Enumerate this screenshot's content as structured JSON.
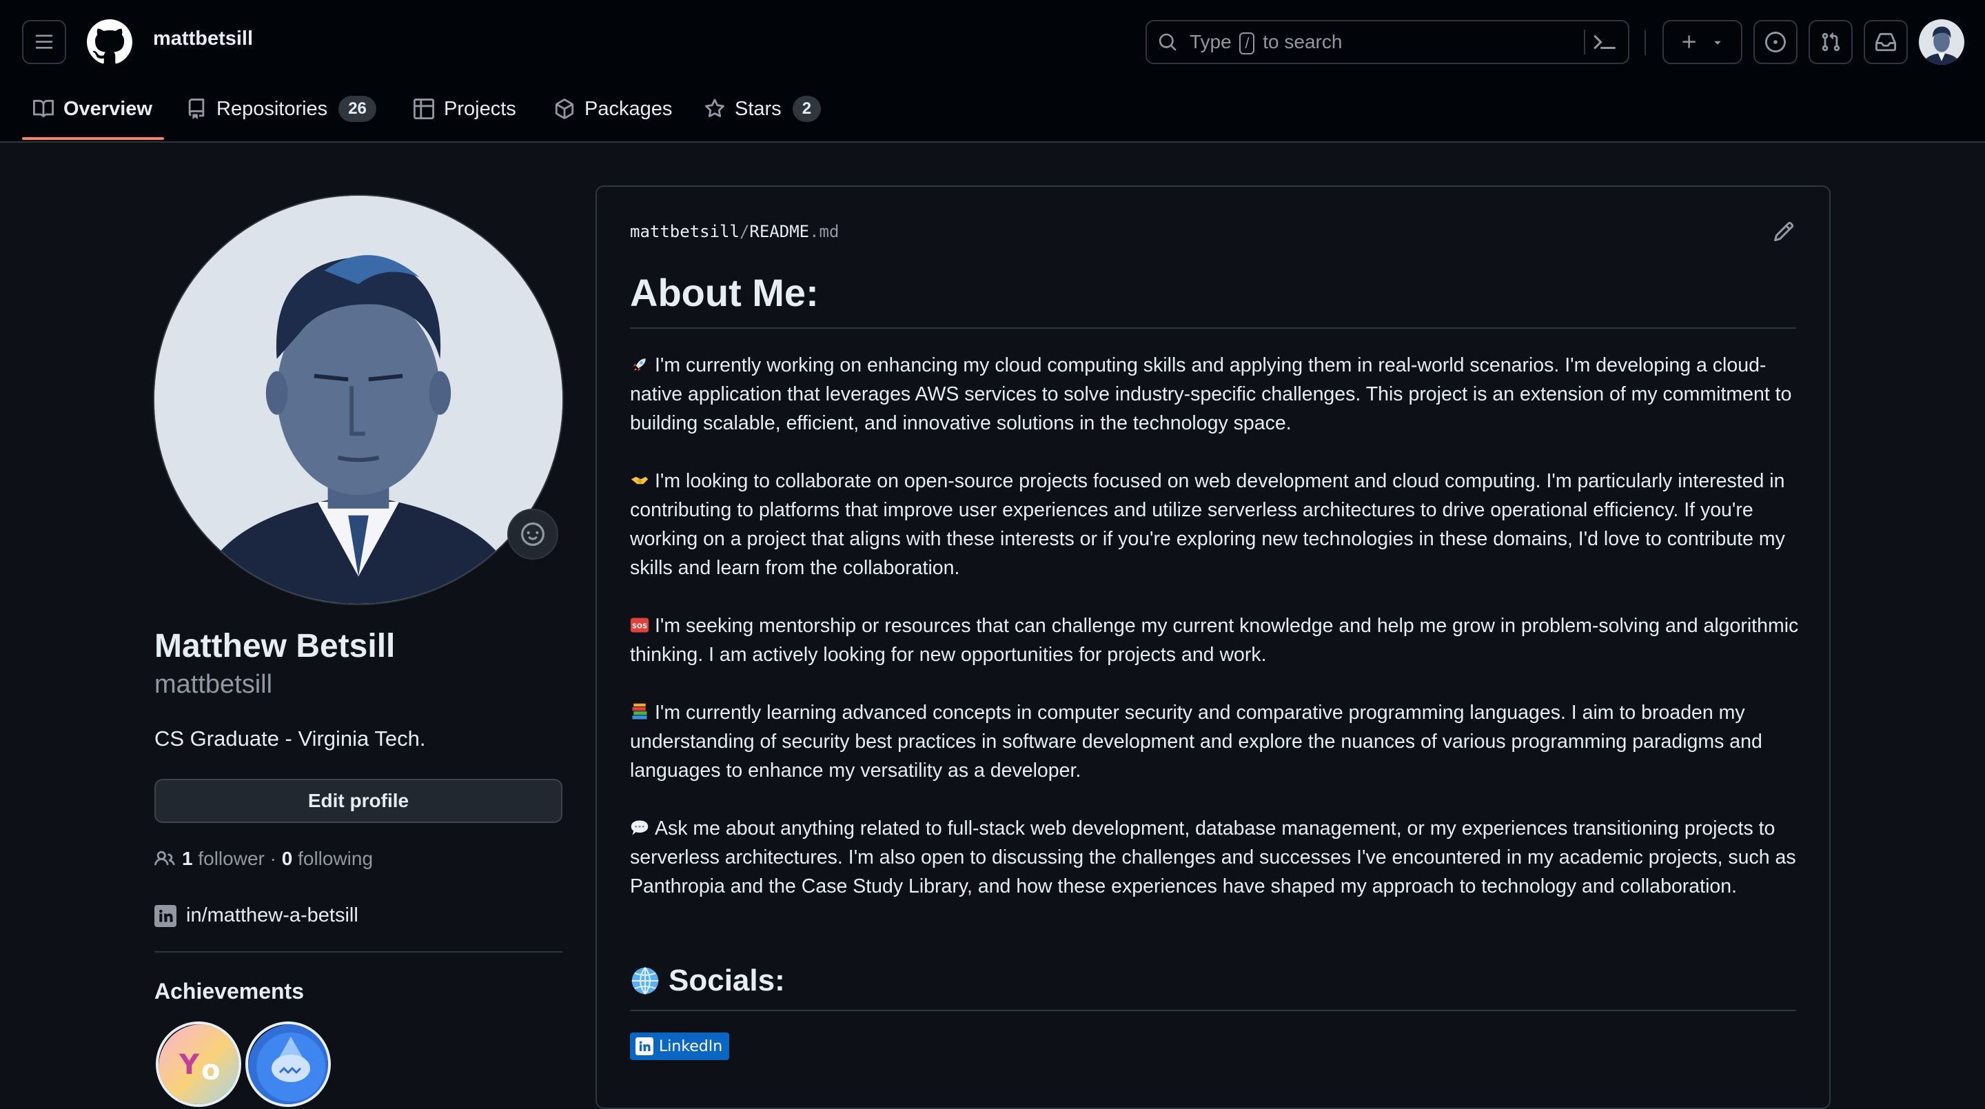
{
  "header": {
    "username": "mattbetsill",
    "search": {
      "prefix": "Type",
      "key": "/",
      "suffix": "to search"
    }
  },
  "tabs": [
    {
      "label": "Overview",
      "icon": "book-icon"
    },
    {
      "label": "Repositories",
      "icon": "repo-icon",
      "count": "26"
    },
    {
      "label": "Projects",
      "icon": "table-icon"
    },
    {
      "label": "Packages",
      "icon": "package-icon"
    },
    {
      "label": "Stars",
      "icon": "star-icon",
      "count": "2"
    }
  ],
  "profile": {
    "name": "Matthew Betsill",
    "login": "mattbetsill",
    "bio": "CS Graduate - Virginia Tech.",
    "edit_label": "Edit profile",
    "followers": "1",
    "followers_label": "follower",
    "dot": "·",
    "following": "0",
    "following_label": "following",
    "linkedin": "in/matthew-a-betsill",
    "achievements_title": "Achievements"
  },
  "readme": {
    "owner": "mattbetsill",
    "slash": "/",
    "file": "README",
    "ext": ".md",
    "heading": "About Me:",
    "paragraphs": [
      {
        "emoji": "rocket",
        "text": "I'm currently working on enhancing my cloud computing skills and applying them in real-world scenarios. I'm developing a cloud-native application that leverages AWS services to solve industry-specific challenges. This project is an extension of my commitment to building scalable, efficient, and innovative solutions in the technology space."
      },
      {
        "emoji": "handshake",
        "text": "I'm looking to collaborate on open-source projects focused on web development and cloud computing. I'm particularly interested in contributing to platforms that improve user experiences and utilize serverless architectures to drive operational efficiency. If you're working on a project that aligns with these interests or if you're exploring new technologies in these domains, I'd love to contribute my skills and learn from the collaboration."
      },
      {
        "emoji": "sos",
        "text": "I'm seeking mentorship or resources that can challenge my current knowledge and help me grow in problem-solving and algorithmic thinking. I am actively looking for new opportunities for projects and work."
      },
      {
        "emoji": "books",
        "text": "I'm currently learning advanced concepts in computer security and comparative programming languages. I aim to broaden my understanding of security best practices in software development and explore the nuances of various programming paradigms and languages to enhance my versatility as a developer."
      },
      {
        "emoji": "speech-balloon",
        "text": "Ask me about anything related to full-stack web development, database management, or my experiences transitioning projects to serverless architectures. I'm also open to discussing the challenges and successes I've encountered in my academic projects, such as Panthropia and the Case Study Library, and how these experiences have shaped my approach to technology and collaboration."
      }
    ],
    "socials_heading": "Socials:",
    "linkedin_badge": "LinkedIn"
  },
  "colors": {
    "background": "#0d1117",
    "header_bg": "#010409",
    "border": "#30363d",
    "text": "#e6edf3",
    "muted": "#9198a1",
    "tab_accent": "#f78166",
    "linkedin": "#0a66c2"
  }
}
